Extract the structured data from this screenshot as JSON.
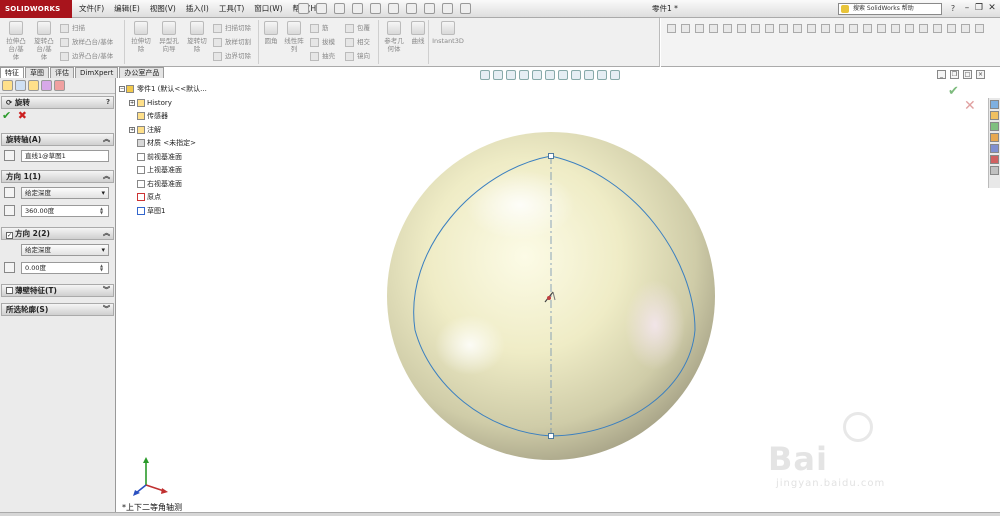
{
  "app": {
    "logo": "SOLIDWORKS",
    "doc_title": "零件1 *"
  },
  "menu": [
    "文件(F)",
    "编辑(E)",
    "视图(V)",
    "插入(I)",
    "工具(T)",
    "窗口(W)",
    "帮助(H)"
  ],
  "search": {
    "placeholder": "搜索 SolidWorks 帮助"
  },
  "window_controls": {
    "help": "?",
    "minimize": "–",
    "restore": "❐",
    "close": "✕"
  },
  "ribbon": {
    "extrude_boss": "拉伸凸\n台/基\n体",
    "revolve_boss": "旋转凸\n台/基\n体",
    "sweep": "扫描",
    "loft_boss": "放样凸台/基体",
    "boundary_boss": "边界凸台/基体",
    "extrude_cut": "拉伸切\n除",
    "hole_wizard": "异型孔\n向导",
    "revolve_cut": "旋转切\n除",
    "swept_cut": "扫描切除",
    "lofted_cut": "放样切割",
    "boundary_cut": "边界切除",
    "fillet": "圆角",
    "linear_pattern": "线性阵\n列",
    "rib": "筋",
    "draft": "拔模",
    "shell": "抽壳",
    "wrap": "包覆",
    "intersect": "相交",
    "mirror": "镜向",
    "ref_geometry": "参考几\n何体",
    "curves": "曲线",
    "instant3d": "Instant3D"
  },
  "tabs": [
    "特征",
    "草图",
    "评估",
    "DimXpert",
    "办公室产品"
  ],
  "property_manager": {
    "title": "旋转",
    "help": "?",
    "ok": "✔",
    "cancel": "✖",
    "axis_section": "旋转轴(A)",
    "axis_value": "直线1@草图1",
    "dir1_section": "方向 1(1)",
    "dir1_type": "给定深度",
    "dir1_angle": "360.00度",
    "dir2_section": "方向 2(2)",
    "dir2_checked": true,
    "dir2_type": "给定深度",
    "dir2_angle": "0.00度",
    "thin_section": "薄壁特征(T)",
    "contours_section": "所选轮廓(S)"
  },
  "tree": {
    "root": "零件1 (默认<<默认...",
    "items": [
      "History",
      "传感器",
      "注解",
      "材质 <未指定>",
      "前视基准面",
      "上视基准面",
      "右视基准面",
      "原点",
      "草图1"
    ]
  },
  "viewport": {
    "view_label": "*上下二等角轴测",
    "ok": "✔",
    "cancel": "✕"
  },
  "watermark": {
    "brand": "Bai",
    "sub": "jingyan.baidu.com"
  },
  "colors": {
    "logo_bg": "#a8141c",
    "sketch_line": "#3a7fc0",
    "sphere_light": "#fbf9d8",
    "sphere_dark": "#a8a488"
  }
}
